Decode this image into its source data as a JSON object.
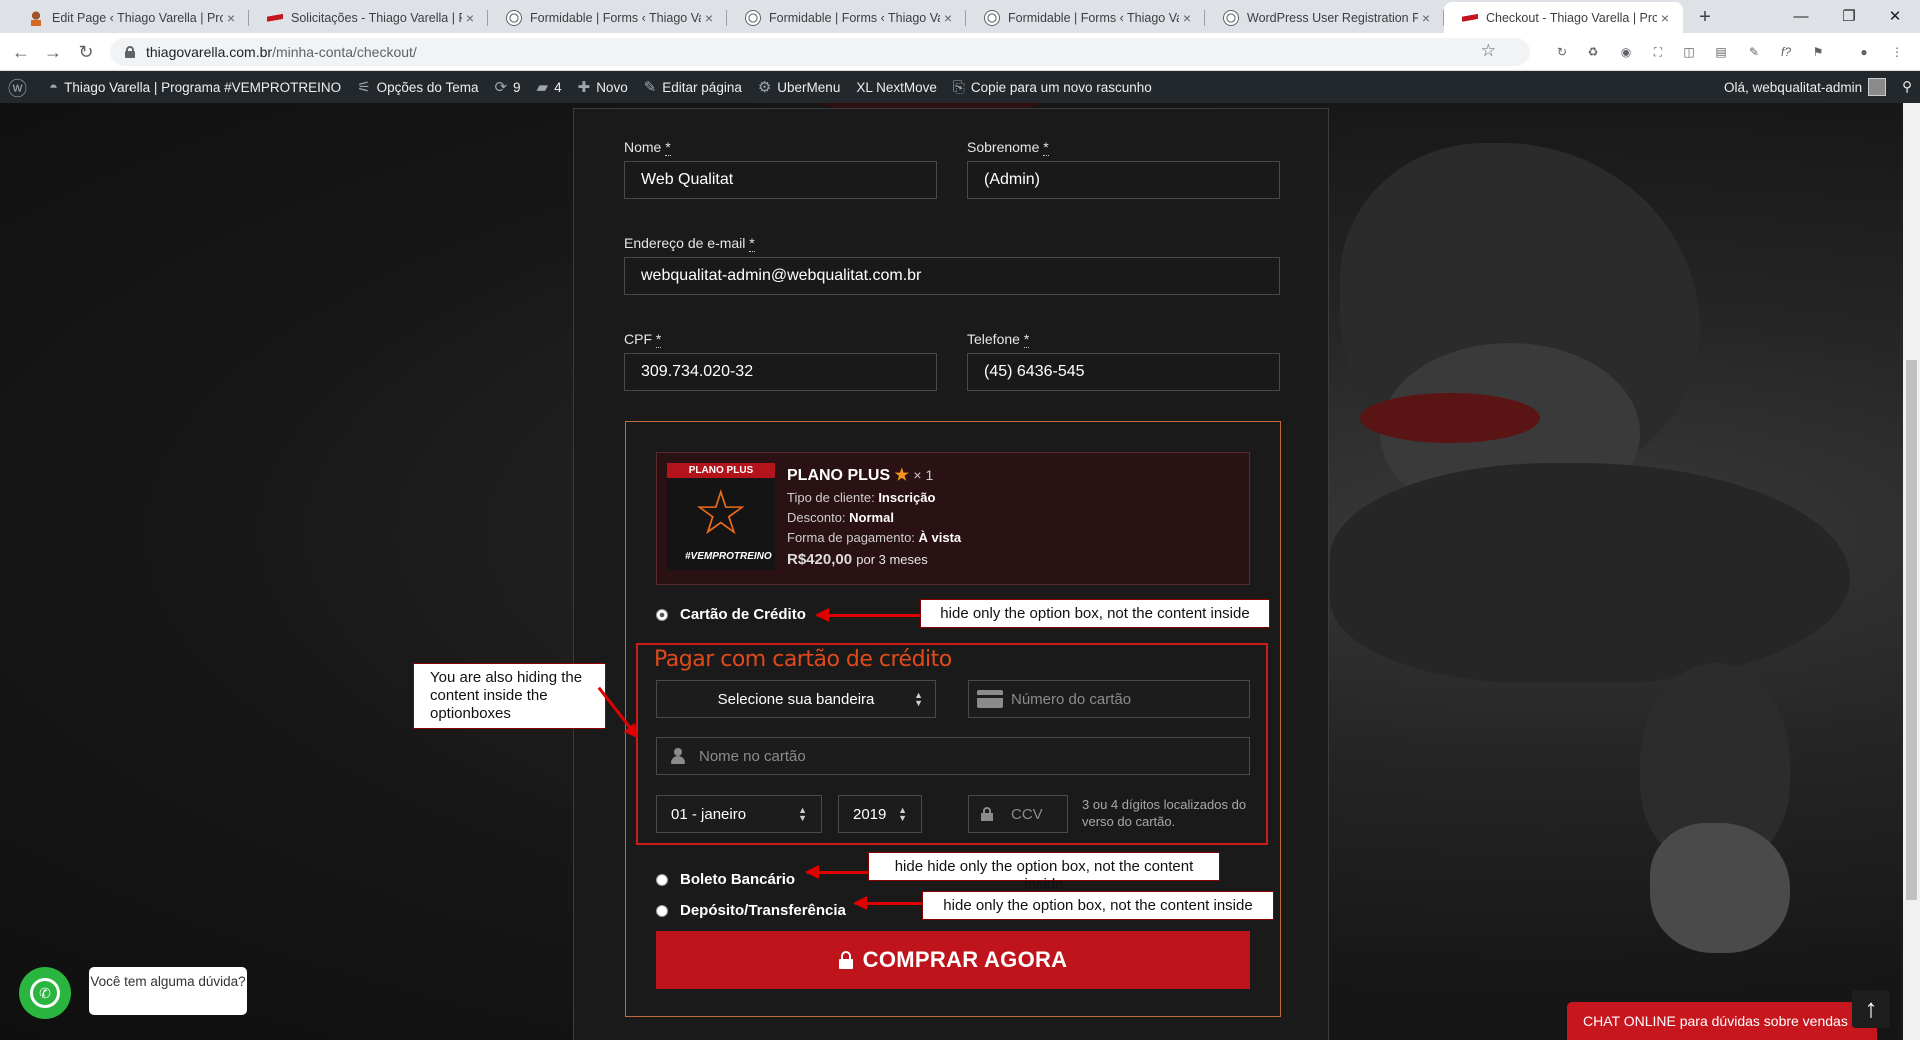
{
  "browser": {
    "tabs": [
      {
        "title": "Edit Page ‹ Thiago Varella | Progr",
        "icon": "edit-page-favicon"
      },
      {
        "title": "Solicitações - Thiago Varella | Pro",
        "icon": "red-stripe-favicon"
      },
      {
        "title": "Formidable | Forms ‹ Thiago Vare",
        "icon": "wordpress-favicon"
      },
      {
        "title": "Formidable | Forms ‹ Thiago Vare",
        "icon": "wordpress-favicon"
      },
      {
        "title": "Formidable | Forms ‹ Thiago Vare",
        "icon": "wordpress-favicon"
      },
      {
        "title": "WordPress User Registration For",
        "icon": "wordpress-favicon"
      },
      {
        "title": "Checkout - Thiago Varella | Prog",
        "icon": "red-stripe-favicon",
        "active": true
      }
    ],
    "close_glyph": "×",
    "new_tab": "+",
    "window_controls": {
      "minimize": "—",
      "maximize": "❐",
      "close": "✕"
    },
    "url_host": "thiagovarella.com.br",
    "url_path": "/minha-conta/checkout/",
    "nav": {
      "back": "←",
      "forward": "→",
      "reload": "↻"
    },
    "bookmark": "☆",
    "extensions": [
      "↻",
      "♻",
      "◉",
      "⛶",
      "◫",
      "▤",
      "✎",
      "f?",
      "⚑",
      "●",
      "⋮"
    ]
  },
  "adminbar": {
    "wp_logo": "ⓦ",
    "site_name": "Thiago Varella | Programa #VEMPROTREINO",
    "theme_options": "Opções do Tema",
    "updates_count": "9",
    "comments_count": "4",
    "new": "Novo",
    "edit_page": "Editar página",
    "ubermenu": "UberMenu",
    "nextmove": "XL NextMove",
    "copy_draft": "Copie para um novo rascunho",
    "greeting": "Olá, webqualitat-admin",
    "search": "⚲"
  },
  "form": {
    "first_name_label": "Nome",
    "first_name_value": "Web Qualitat",
    "last_name_label": "Sobrenome",
    "last_name_value": "(Admin)",
    "email_label": "Endereço de e-mail",
    "email_value": "webqualitat-admin@webqualitat.com.br",
    "cpf_label": "CPF",
    "cpf_value": "309.734.020-32",
    "phone_label": "Telefone",
    "phone_value": "(45) 6436-545",
    "required_mark": "*"
  },
  "product": {
    "ribbon": "PLANO PLUS",
    "brand": "#VEMPROTREINO",
    "name": "PLANO PLUS",
    "qty": "× 1",
    "client_type_label": "Tipo de cliente:",
    "client_type_value": "Inscrição",
    "discount_label": "Desconto:",
    "discount_value": "Normal",
    "payment_label": "Forma de pagamento:",
    "payment_value": "À vista",
    "price": "R$420,00",
    "period": "por 3 meses"
  },
  "payment": {
    "credit_card": "Cartão de Crédito",
    "cc_title": "Pagar com cartão de crédito",
    "brand_select": "Selecione sua bandeira",
    "card_number_placeholder": "Número do cartão",
    "card_name_placeholder": "Nome no cartão",
    "month_value": "01 - janeiro",
    "year_value": "2019",
    "ccv_placeholder": "CCV",
    "ccv_hint": "3 ou 4 dígitos localizados do verso do cartão.",
    "boleto": "Boleto Bancário",
    "deposit": "Depósito/Transferência",
    "buy_button": "COMPRAR AGORA"
  },
  "annotations": {
    "note_credit": "hide only the option box, not the content inside",
    "note_content": "You are also hiding the content inside the optionboxes",
    "note_boleto": "hide hide only the option box, not the content inside",
    "note_deposit": "hide only the option box, not the content inside"
  },
  "widgets": {
    "whatsapp_bubble": "Você tem alguma dúvida?",
    "chat_online": "CHAT ONLINE para dúvidas sobre vendas",
    "to_top": "↑"
  }
}
